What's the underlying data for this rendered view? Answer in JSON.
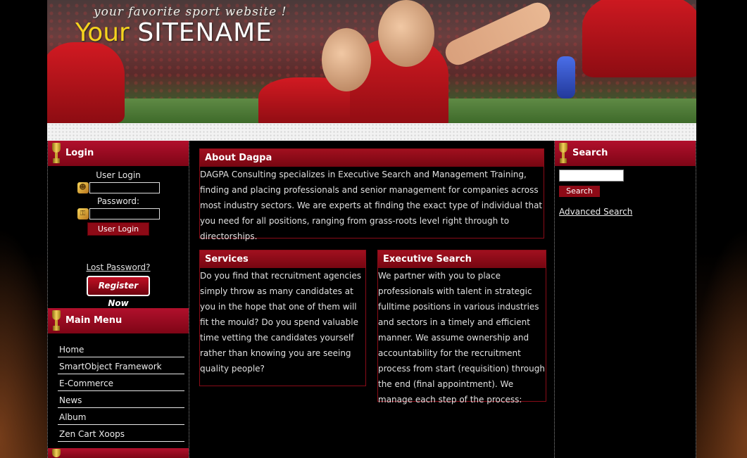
{
  "header": {
    "tagline": "your favorite sport website !",
    "site_name_first": "Your",
    "site_name_second": "SITENAME"
  },
  "login": {
    "title": "Login",
    "user_label": "User Login",
    "password_label": "Password:",
    "button": "User Login",
    "lost_password": "Lost Password?",
    "register": "Register Now"
  },
  "main_menu": {
    "title": "Main Menu",
    "items": [
      "Home",
      "SmartObject Framework",
      "E-Commerce",
      "News",
      "Album",
      "Zen Cart Xoops"
    ]
  },
  "about": {
    "title": "About Dagpa",
    "text": "DAGPA Consulting specializes in Executive Search and Management Training, finding and placing professionals and senior management for companies across most industry sectors. We are experts at finding the exact type of individual that you need for all positions, ranging from grass-roots level right through to directorships."
  },
  "services": {
    "title": "Services",
    "text": "Do you find that recruitment agencies simply throw as many candidates at you in the hope that one of them will fit the mould? Do you spend valuable time vetting the candidates yourself rather than knowing you are seeing quality people?"
  },
  "executive_search": {
    "title": "Executive Search",
    "text": "We partner with you to place professionals with talent in strategic fulltime positions in various industries and sectors in a timely and efficient manner. We assume ownership and accountability for the recruitment process from start (requisition) through the end (final appointment). We manage each step of the process:"
  },
  "search": {
    "title": "Search",
    "button": "Search",
    "advanced": "Advanced Search"
  },
  "colors": {
    "accent_red": "#8d0a16",
    "header_red": "#b1102c",
    "logo_yellow": "#f5d21e"
  },
  "icons": [
    "trophy-icon",
    "user-icon",
    "key-icon"
  ]
}
